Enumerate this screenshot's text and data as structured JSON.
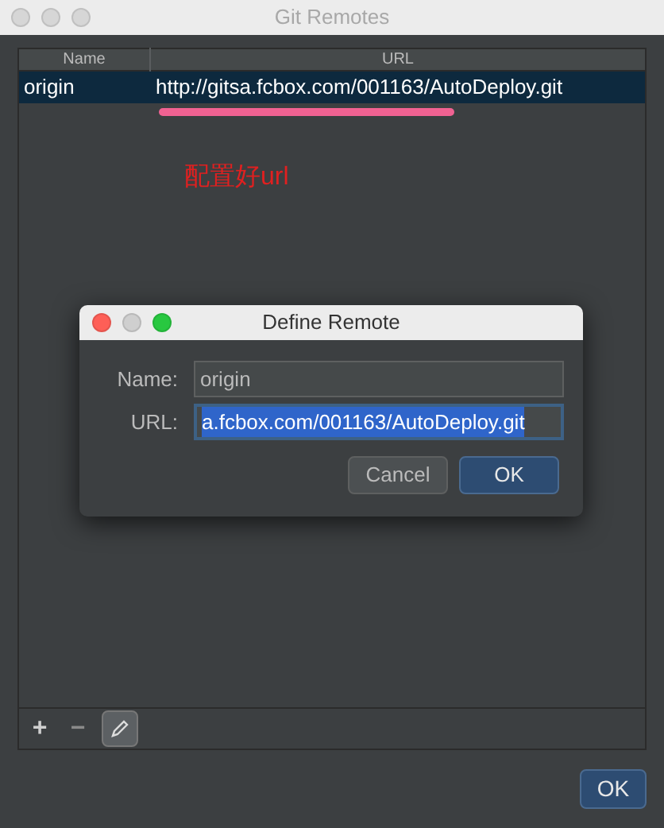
{
  "window": {
    "title": "Git Remotes"
  },
  "table": {
    "columns": [
      "Name",
      "URL"
    ],
    "rows": [
      {
        "name": "origin",
        "url": "http://gitsa.fcbox.com/001163/AutoDeploy.git",
        "selected": true
      }
    ]
  },
  "annotation": {
    "text": "配置好url"
  },
  "toolbar": [
    "+",
    "−"
  ],
  "buttons": [
    "OK"
  ],
  "dialog": {
    "title": "Define Remote",
    "fields": [
      {
        "label": "Name:",
        "value": "origin",
        "focused": false
      },
      {
        "label": "URL:",
        "value": "a.fcbox.com/001163/AutoDeploy.git",
        "focused": true
      }
    ],
    "buttons": [
      {
        "label": "Cancel",
        "default": false
      },
      {
        "label": "OK",
        "default": true
      }
    ]
  }
}
